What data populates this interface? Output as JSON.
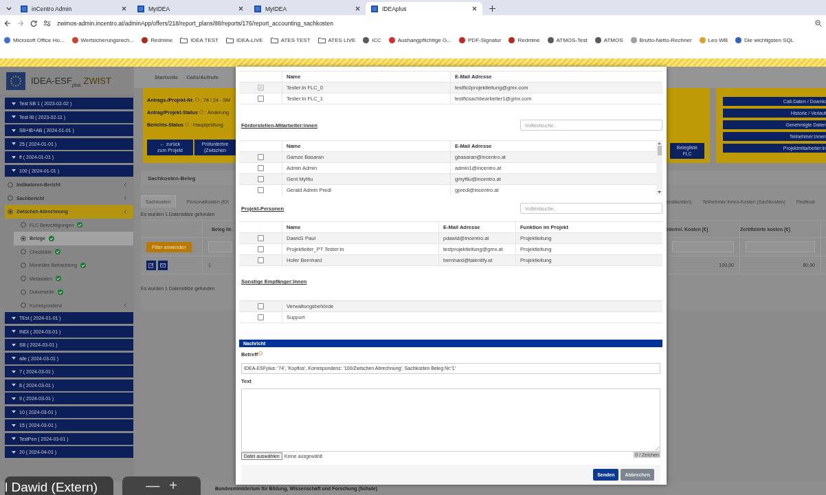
{
  "browser": {
    "tabs": [
      {
        "title": "inCentro Admin",
        "selected": false
      },
      {
        "title": "MyIDEA",
        "selected": false
      },
      {
        "title": "MyIDEA",
        "selected": false
      },
      {
        "title": "IDEAplus",
        "selected": true
      }
    ],
    "address": "zwimos-admin.incentro.at/adminApp/offers/218/report_plans/88/reports/176/report_accounting_sachkosten",
    "bookmarks": [
      {
        "label": "Microsoft Office Ho...",
        "kind": "site",
        "color": "#3b6fd4"
      },
      {
        "label": "Wertsicherungsrech...",
        "kind": "site",
        "color": "#d0402a"
      },
      {
        "label": "Redmine",
        "kind": "site",
        "color": "#b02a20"
      },
      {
        "label": "IDEA TEST",
        "kind": "folder"
      },
      {
        "label": "IDEA-LIVE",
        "kind": "folder"
      },
      {
        "label": "ATES TEST",
        "kind": "folder"
      },
      {
        "label": "ATES LIVE",
        "kind": "folder"
      },
      {
        "label": "iCC",
        "kind": "site",
        "color": "#5a5a5a"
      },
      {
        "label": "Aushangpflichtige G...",
        "kind": "site",
        "color": "#d03030"
      },
      {
        "label": "PDF-Signatur",
        "kind": "site",
        "color": "#c02828"
      },
      {
        "label": "Redmine",
        "kind": "site",
        "color": "#b02a20"
      },
      {
        "label": "ATMOS-Test",
        "kind": "site",
        "color": "#5a5a5a"
      },
      {
        "label": "ATMOS",
        "kind": "site",
        "color": "#5a5a5a"
      },
      {
        "label": "Brutto-Netto-Rechner",
        "kind": "site",
        "color": "#a0a0a0"
      },
      {
        "label": "Leo WB",
        "kind": "site",
        "color": "#e0a030"
      },
      {
        "label": "Die wichtigsten SQL",
        "kind": "site",
        "color": "#3060c0"
      }
    ]
  },
  "sidebar": {
    "logo": {
      "title": "IDEA-ESF",
      "subscript": "plus",
      "suffix": "ZWIST"
    },
    "items": [
      {
        "label": "Test SB 1 ( 2023-02-02 )"
      },
      {
        "label": "Test IB ( 2023-02-11 )"
      },
      {
        "label": "SB+IB+AB ( 2024-01-01 )"
      },
      {
        "label": "25 ( 2024-01-01 )"
      },
      {
        "label": "ff ( 2024-01-01 )"
      },
      {
        "label": "100 ( 2024-01-01 )",
        "children": [
          {
            "label": "Indikatoren-Bericht",
            "selected": false,
            "expandable": true
          },
          {
            "label": "Sachbericht",
            "selected": false,
            "expandable": true
          },
          {
            "label": "Zwischen Abrechnung",
            "selected": true,
            "expandable": true,
            "children": [
              {
                "label": "FLC Berechtigungen",
                "selected": false,
                "complete": true,
                "expandable": false
              },
              {
                "label": "Belege",
                "selected": true,
                "complete": true,
                "expandable": false
              },
              {
                "label": "Checkliste",
                "selected": false,
                "complete": true,
                "expandable": false
              },
              {
                "label": "Monetäre Betrachtung",
                "selected": false,
                "complete": true,
                "expandable": false
              },
              {
                "label": "Metadaten",
                "selected": false,
                "complete": true,
                "expandable": false
              },
              {
                "label": "Dokumente",
                "selected": false,
                "complete": true,
                "expandable": false
              },
              {
                "label": "Korrespondenz",
                "selected": false,
                "complete": false,
                "expandable": true
              }
            ]
          }
        ]
      },
      {
        "label": "TEst ( 2024-01-01 )"
      },
      {
        "label": "INDI ( 2024-03-01 )"
      },
      {
        "label": "SB ( 2024-03-01 )"
      },
      {
        "label": "alle ( 2024-03-01 )"
      },
      {
        "label": "7 ( 2024-03-01 )"
      },
      {
        "label": "8 ( 2024-03-01 )"
      },
      {
        "label": "9 ( 2024-03-01 )"
      },
      {
        "label": "10 ( 2024-03-01 )"
      },
      {
        "label": "15 ( 2024-03-01 )"
      },
      {
        "label": "TestPen ( 2024-03-01 )"
      },
      {
        "label": "20 ( 2024-04-01 )"
      }
    ]
  },
  "background": {
    "nav": [
      "Startseite",
      "Calls/Aufrufe"
    ],
    "info": [
      {
        "label": "Antrags-/Projekt-Nr.",
        "value": ": 74 / 24 - SM"
      },
      {
        "label": "Antrag/Projekt-Status",
        "value": ": Änderung"
      },
      {
        "label": "Berichts-Status",
        "value": ": Hauptprüfung"
      }
    ],
    "left_buttons": [
      "← zurück\nzum Projekt",
      "Prüfunterbre\n(Zwischen"
    ],
    "right_small_button": "Belegliste\nFLC",
    "right_buttons": [
      "Call-Daten / Downlo",
      "Historie / Verlauf",
      "Genehmigte Daten",
      "Teilnehmer:innen",
      "Projektmitarbeiter:in"
    ],
    "panel_title": "Sachkosten-Beleg",
    "left_tabs": [
      {
        "label": "Sachkosten",
        "selected": true
      },
      {
        "label": "Personalkosten (EK",
        "selected": false
      }
    ],
    "right_tabs": [
      {
        "label": "onalkosten)",
        "selected": false
      },
      {
        "label": "Teilnehmer:innen-Kosten (Sachkosten)",
        "selected": false
      },
      {
        "label": "Restkost",
        "selected": false
      }
    ],
    "result_count": "Es wurden 1 Datensätze gefunden",
    "result_count_bottom": "Es wurden 1 Datensätze gefunden",
    "left_column": "Beleg Nr.",
    "filter_button": "Filter anwenden",
    "left_cell": "1",
    "right_columns": [
      "rderrel. Kosten [€]",
      "Zertifizierte kosten [€]"
    ],
    "right_cells": [
      "100,00",
      "80,00"
    ]
  },
  "modal": {
    "sections": [
      {
        "kind": "plain",
        "columns": [
          "Name",
          "E-Mail Adresse"
        ],
        "rows": [
          {
            "checked": true,
            "disabled": true,
            "cells": [
              "Tester:in FLC_0",
              "testflc0projektleitung@gmx.com"
            ]
          },
          {
            "checked": false,
            "disabled": false,
            "cells": [
              "Tester:in FLC_1",
              "testflcsachbearbeiter1@gmx.com"
            ]
          }
        ]
      },
      {
        "kind": "scrolling",
        "title": "Förderstellen-Mitarbeiter:innen",
        "search_placeholder": "Volltextsuche..",
        "columns": [
          "Name",
          "E-Mail Adresse"
        ],
        "rows": [
          {
            "checked": false,
            "cells": [
              "Gamze Basaran",
              "gbasaran@incentro.at"
            ]
          },
          {
            "checked": false,
            "cells": [
              "Admin Admin",
              "admin1@incentro.at"
            ]
          },
          {
            "checked": false,
            "cells": [
              "Gent Myftiu",
              "gmyftiu@incentro.at"
            ]
          },
          {
            "checked": false,
            "cells": [
              "Gerald Admin Predl",
              "gpredl@incentro.at"
            ]
          }
        ]
      },
      {
        "kind": "plain",
        "title": "Projekt-Personen",
        "search_placeholder": "Volltextsuche..",
        "columns": [
          "Name",
          "E-Mail Adresse",
          "Funktion im Projekt"
        ],
        "rows": [
          {
            "checked": false,
            "cells": [
              "Dawid1 Paul",
              "pdawid@incentro.at",
              "Projektleitung"
            ]
          },
          {
            "checked": false,
            "cells": [
              "Projektleiter_PT Tester:in",
              "testprojektleitung@gmx.at",
              "Projektleitung"
            ]
          },
          {
            "checked": false,
            "cells": [
              "Hofer Bernhard",
              "bernhard@talentify.at",
              "Projektleitung"
            ]
          }
        ]
      },
      {
        "kind": "plain",
        "title": "Sonstige Empfänger:innen",
        "rows": [
          {
            "checked": false,
            "cells": [
              "Verwaltungsbehörde"
            ]
          },
          {
            "checked": false,
            "cells": [
              "Support"
            ]
          }
        ]
      }
    ],
    "message": {
      "title": "Nachricht",
      "subject_label": "Betreff",
      "subject": "IDEA-ESFplus:  '74', 'Kopflos', Korrespondenz: '100/Zwischen Abrechnung', Sachkosten Beleg Nr:'1'",
      "text_label": "Text",
      "file_button": "Datei auswählen",
      "file_status": "Keine ausgewählt",
      "counter": "0 / Zeichen"
    },
    "buttons": [
      {
        "label": "Senden",
        "kind": "primary"
      },
      {
        "label": "Abbrechen",
        "kind": "secondary"
      }
    ]
  },
  "footer": {
    "ministry": "Bundesministerium für Bildung, Wissenschaft und Forschung (Schule)"
  },
  "video_overlay": {
    "caption": "l Dawid (Extern)",
    "controls": [
      "—",
      "+"
    ]
  }
}
